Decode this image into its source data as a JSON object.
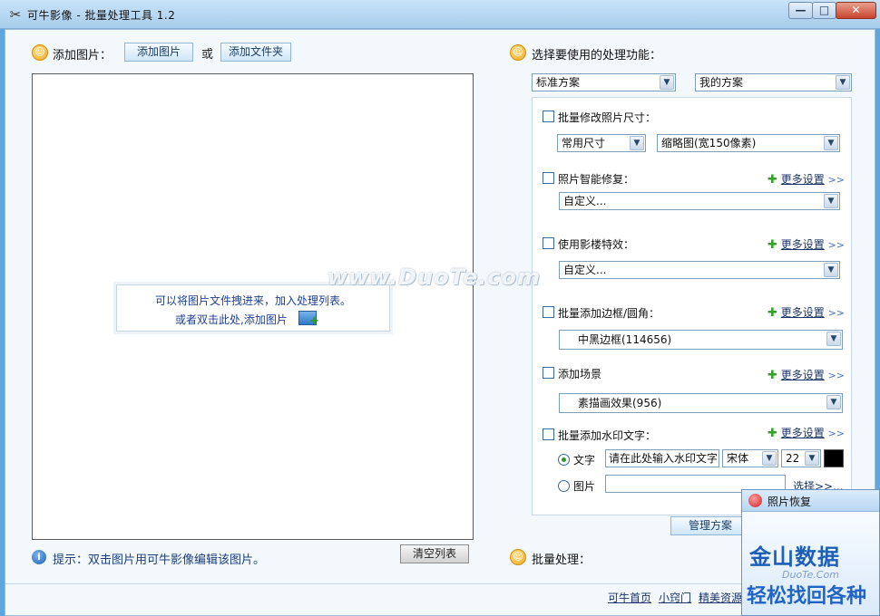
{
  "window": {
    "title": "可牛影像 - 批量处理工具 1.2",
    "buttons": {
      "minimize": "—",
      "maximize": "□",
      "close": "✕"
    }
  },
  "left": {
    "add_label": "添加图片：",
    "add_images_button": "添加图片",
    "or_text": "或",
    "add_folder_button": "添加文件夹",
    "drop_hint_line1": "可以将图片文件拽进来，加入处理列表。",
    "drop_hint_line2": "或者双击此处,添加图片",
    "tip": "提示：双击图片用可牛影像编辑该图片。",
    "clear_list_button": "清空列表"
  },
  "right": {
    "section_label": "选择要使用的处理功能：",
    "scheme_select": "标准方案",
    "my_scheme_select": "我的方案",
    "options": {
      "resize": {
        "label": "批量修改照片尺寸：",
        "size_type": "常用尺寸",
        "size_value": "缩略图(宽150像素)"
      },
      "repair": {
        "label": "照片智能修复：",
        "value": "自定义..."
      },
      "effects": {
        "label": "使用影楼特效：",
        "value": "自定义..."
      },
      "border": {
        "label": "批量添加边框/圆角：",
        "value": "中黑边框(114656)"
      },
      "scene": {
        "label": "添加场景",
        "value": "素描画效果(956)"
      },
      "watermark": {
        "label": "批量添加水印文字：",
        "text_radio": "文字",
        "text_value": "请在此处输入水印文字",
        "font": "宋体",
        "font_size": "22",
        "color": "#000000",
        "image_radio": "图片",
        "choose": "选择>>..."
      }
    },
    "more_settings": "更多设置",
    "more_arrows": ">>",
    "manage_button": "管理方案",
    "batch_label": "批量处理："
  },
  "footer": {
    "links": [
      "可牛首页",
      "小窍门",
      "精美资源"
    ]
  },
  "overlay_watermark": "www.DuoTe.com",
  "popup": {
    "title": "照片恢复",
    "ad_big": "金山数据",
    "ad_watermark": "DuoTe.Com",
    "ad_small": "轻松找回各种"
  }
}
